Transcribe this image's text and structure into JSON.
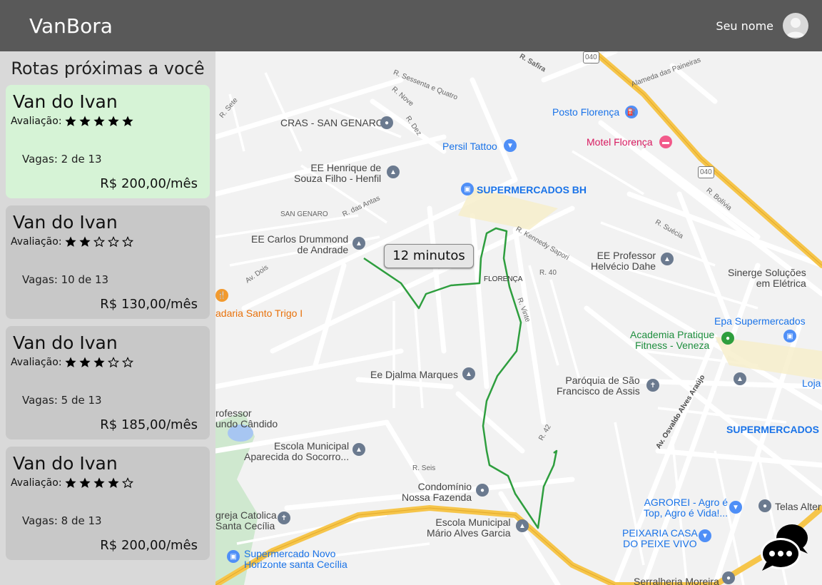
{
  "header": {
    "brand": "VanBora",
    "user_name": "Seu nome",
    "avatar_icon": "user-avatar-icon"
  },
  "sidebar": {
    "title": "Rotas próximas a você",
    "rating_label": "Avaliação:",
    "routes": [
      {
        "name": "Van do Ivan",
        "rating": 5,
        "vagas": "Vagas: 2 de 13",
        "price": "R$ 200,00/mês",
        "selected": true
      },
      {
        "name": "Van do Ivan",
        "rating": 2,
        "vagas": "Vagas: 10 de 13",
        "price": "R$ 130,00/mês",
        "selected": false
      },
      {
        "name": "Van do Ivan",
        "rating": 3,
        "vagas": "Vagas: 5 de 13",
        "price": "R$ 185,00/mês",
        "selected": false
      },
      {
        "name": "Van do Ivan",
        "rating": 4,
        "vagas": "Vagas: 8 de 13",
        "price": "R$ 200,00/mês",
        "selected": false
      }
    ]
  },
  "map": {
    "route_time": "12 minutos",
    "labels": {
      "cras": "CRAS - SAN GENARO",
      "posto": "Posto Florença",
      "motel": "Motel Florença",
      "persil": "Persil Tattoo",
      "henrique": "EE Henrique de\nSouza Filho - Henfil",
      "supermercados_bh": "SUPERMERCADOS BH",
      "san_genaro": "SAN GENARO",
      "carlos": "EE Carlos Drummond\nde Andrade",
      "professor_helvecio": "EE Professor\nHelvécio Dahe",
      "sinergie": "Sinerge Soluções\nem Elétrica",
      "padaria": "adaria Santo Trigo I",
      "epa": "Epa Supermercados",
      "academia": "Academia Pratique\nFitness - Veneza",
      "djalma": "Ee Djalma Marques",
      "paroquia": "Paróquia de São\nFrancisco de Assis",
      "loja": "Loja",
      "professor_candido": "rofessor\nundo Cândido",
      "supermercados_b2": "SUPERMERCADOS B",
      "escola_aparecida": "Escola Municipal\nAparecida do Socorro...",
      "condominio": "Condomínio\nNossa Fazenda",
      "agrorei": "AGROREI - Agro é\nTop, Agro é Vida!...",
      "telas": "Telas Alter",
      "igreja": "greja Catolica\nSanta Cecília",
      "escola_mario": "Escola Municipal\nMário Alves Garcia",
      "peixaria": "PEIXARIA CASA\nDO PEIXE VIVO",
      "supermercado_novo": "Supermercado Novo\nHorizonte santa Cecília",
      "serralheria": "Serralheria Moreira",
      "florenca": "FLORENÇA",
      "av_osvaldo": "Av. Osvaldo Alves Araújo",
      "av_dois": "Av. Dois",
      "alameda_paineiras": "Alameda das Paineiras",
      "r_40": "R. 40",
      "r_42": "R. 42",
      "r_seis": "R. Seis",
      "r_sete": "R. Sete",
      "r_vinte": "R. Vinte",
      "r_kennedy": "R. Kennedy Sapori",
      "r_sessenta": "R. Sessenta e Quatro",
      "r_nove": "R. Nove",
      "r_dez": "R. Dez",
      "r_das_antas": "R. das Antas",
      "r_bolivia": "R. Bolívia",
      "r_suecia": "R. Suécia",
      "r_safira": "R. Safira",
      "badge_040a": "040",
      "badge_040b": "040"
    }
  },
  "colors": {
    "header_bg": "#595959",
    "sidebar_bg": "#d9d9d9",
    "card_bg": "#c8c8c8",
    "card_selected_bg": "#d6f3d6",
    "route_line": "#2e9e3e",
    "highway": "#f6c54a"
  },
  "icons": {
    "star_full": "star-filled-icon",
    "star_empty": "star-outline-icon",
    "chat": "chat-bubbles-icon"
  }
}
